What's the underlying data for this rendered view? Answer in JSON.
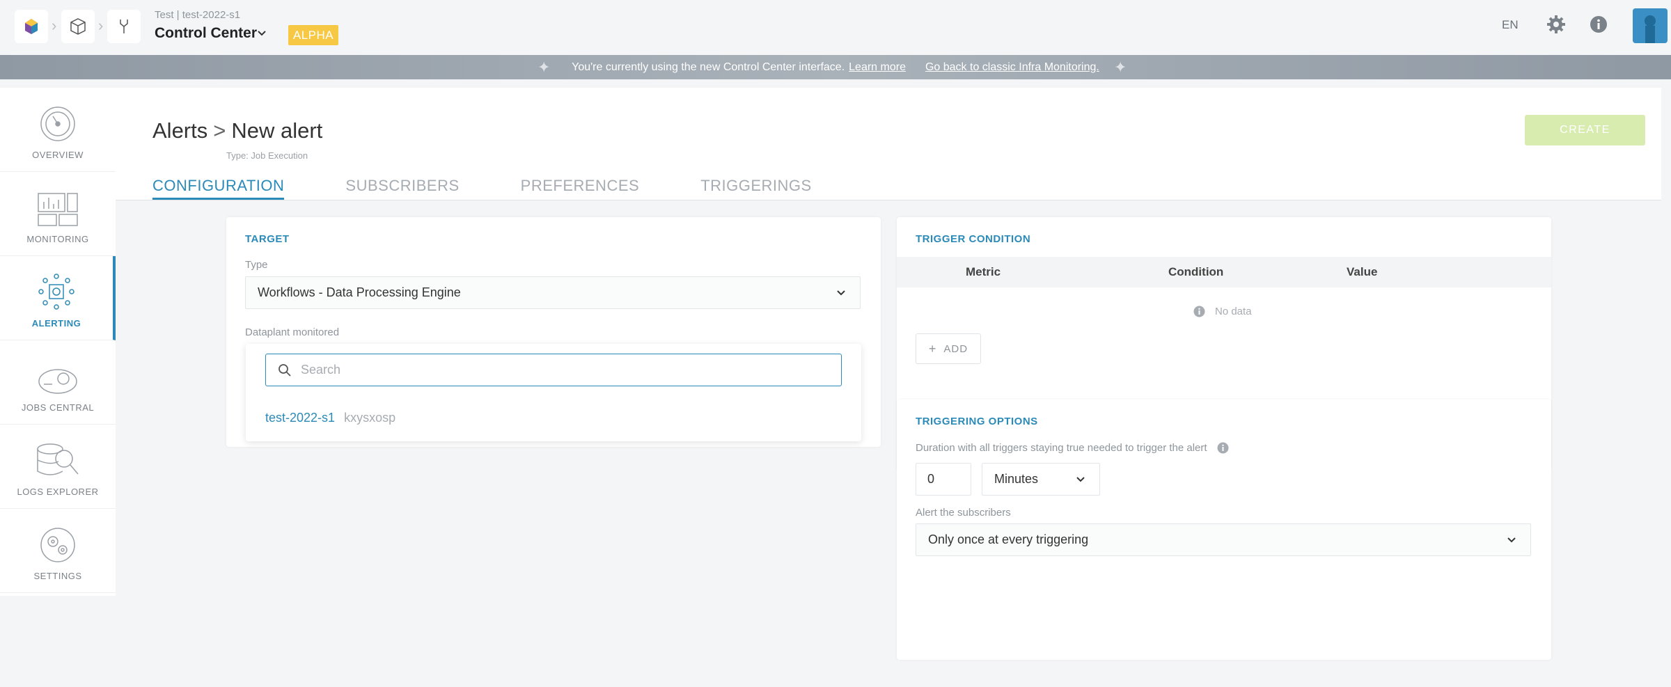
{
  "topbar": {
    "project_path": "Test | test-2022-s1",
    "app_title": "Control Center",
    "badge": "ALPHA",
    "lang": "EN",
    "icons": [
      "home-logo-icon",
      "cube-icon",
      "tools-icon",
      "chevron-down-icon",
      "gear-icon",
      "info-icon",
      "user-avatar-icon"
    ]
  },
  "banner": {
    "message": "You're currently using the new Control Center interface.",
    "learn_more": "Learn more",
    "go_back": "Go back to classic Infra Monitoring."
  },
  "sidebar": {
    "items": [
      {
        "label": "OVERVIEW",
        "icon": "speedometer-icon",
        "active": false
      },
      {
        "label": "MONITORING",
        "icon": "dashboard-icon",
        "active": false
      },
      {
        "label": "ALERTING",
        "icon": "alert-chip-icon",
        "active": true
      },
      {
        "label": "JOBS CENTRAL",
        "icon": "jobs-icon",
        "active": false
      },
      {
        "label": "LOGS EXPLORER",
        "icon": "logs-search-icon",
        "active": false
      },
      {
        "label": "SETTINGS",
        "icon": "settings-gears-icon",
        "active": false
      }
    ]
  },
  "page": {
    "breadcrumb_root": "Alerts",
    "breadcrumb_sep": ">",
    "title": "New alert",
    "subtitle": "Type: Job Execution",
    "create_label": "CREATE",
    "tabs": [
      {
        "label": "CONFIGURATION",
        "active": true
      },
      {
        "label": "SUBSCRIBERS",
        "active": false
      },
      {
        "label": "PREFERENCES",
        "active": false
      },
      {
        "label": "TRIGGERINGS",
        "active": false
      }
    ]
  },
  "target": {
    "title": "TARGET",
    "type_label": "Type",
    "type_value": "Workflows - Data Processing Engine",
    "dataplant_label": "Dataplant monitored",
    "search_placeholder": "Search",
    "options": [
      {
        "name": "test-2022-s1",
        "id": "kxysxosp"
      }
    ]
  },
  "trigger_condition": {
    "title": "TRIGGER CONDITION",
    "columns": [
      "Metric",
      "Condition",
      "Value"
    ],
    "no_data": "No data",
    "add_label": "ADD"
  },
  "triggering_options": {
    "title": "TRIGGERING OPTIONS",
    "duration_label": "Duration with all triggers staying true needed to trigger the alert",
    "duration_value": "0",
    "duration_unit": "Minutes",
    "alert_label": "Alert the subscribers",
    "alert_value": "Only once at every triggering"
  },
  "colors": {
    "accent": "#2b8ab8",
    "badge": "#f7c843",
    "create_disabled": "#d8ecb0"
  }
}
